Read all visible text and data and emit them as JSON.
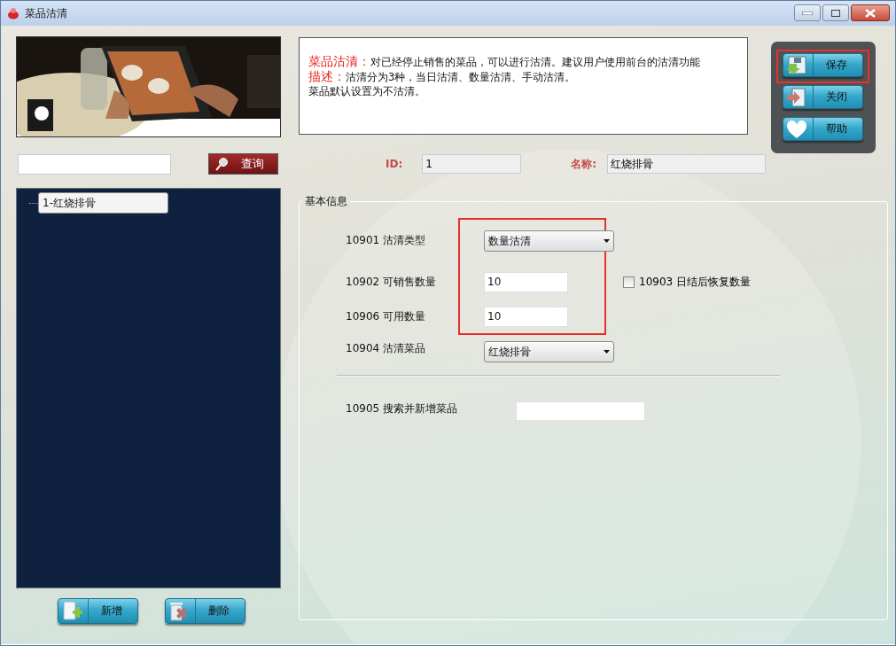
{
  "window": {
    "title": "菜品沽清"
  },
  "info": {
    "lines": [
      {
        "heading": "菜品沽清：",
        "text": "对已经停止销售的菜品，可以进行沽清。建议用户使用前台的沽清功能"
      },
      {
        "heading": "描述：",
        "text": "沽清分为3种，当日沽清、数量沽清、手动沽清。"
      },
      {
        "text": "菜品默认设置为不沽清。"
      }
    ]
  },
  "actions": [
    {
      "label": "保存",
      "kind": "save",
      "highlighted": true
    },
    {
      "label": "关闭",
      "kind": "exit",
      "highlighted": false
    },
    {
      "label": "帮助",
      "kind": "help",
      "highlighted": false
    }
  ],
  "search": {
    "button": "查询"
  },
  "tree": {
    "items": [
      {
        "label": "1-红烧排骨",
        "selected": true
      }
    ]
  },
  "tree_buttons": [
    {
      "label": "新增",
      "kind": "add"
    },
    {
      "label": "删除",
      "kind": "delete"
    }
  ],
  "header_fields": [
    {
      "label": "ID:",
      "value": "1"
    },
    {
      "label": "名称:",
      "value": "红烧排骨"
    }
  ],
  "basic_info": {
    "title": "基本信息",
    "highlight": true,
    "rows": [
      {
        "kind": "select",
        "label": "10901 沽清类型",
        "value": "数量沽清"
      },
      {
        "kind": "input",
        "label": "10902 可销售数量",
        "value": "10",
        "checkbox": {
          "label": "10903 日结后恢复数量",
          "checked": false
        }
      },
      {
        "kind": "input",
        "label": "10906 可用数量",
        "value": "10"
      },
      {
        "kind": "select",
        "label": "10904 沽清菜品",
        "value": "红烧排骨"
      },
      {
        "kind": "separator"
      },
      {
        "kind": "search",
        "label": "10905 搜索并新增菜品"
      }
    ]
  }
}
